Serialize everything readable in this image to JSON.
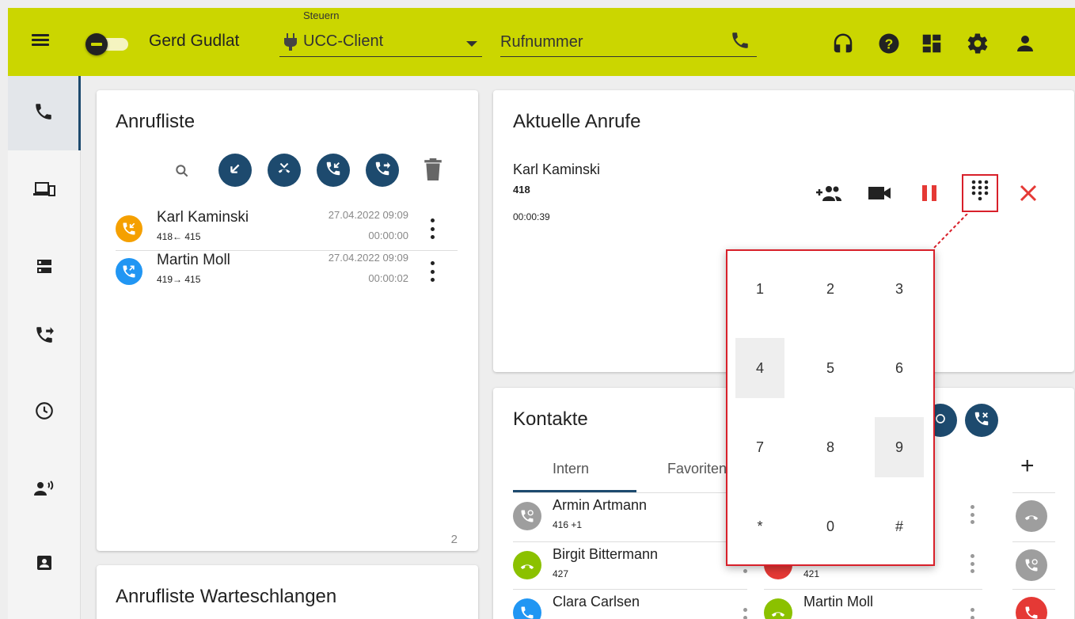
{
  "topbar": {
    "user_name": "Gerd Gudlat",
    "control_label": "Steuern",
    "client_value": "UCC-Client",
    "phone_placeholder": "Rufnummer",
    "bg_color": "#cbd600",
    "icons": [
      "menu-icon",
      "status-toggle",
      "headset-icon",
      "help-icon",
      "dashboard-icon",
      "settings-icon",
      "user-icon"
    ]
  },
  "sidenav": {
    "items": [
      "phone-icon",
      "devices-icon",
      "server-icon",
      "call-forward-icon",
      "clock-icon",
      "voice-icon",
      "contact-card-icon"
    ],
    "active_index": 0
  },
  "call_list": {
    "title": "Anrufliste",
    "footer_count": "2",
    "filter_icons": [
      "search-icon",
      "outgoing-call-icon",
      "missed-call-icon",
      "incoming-call-icon",
      "forwarded-call-icon",
      "delete-icon"
    ],
    "rows": [
      {
        "name": "Karl Kaminski",
        "from": "418",
        "arrow": "←",
        "to": "415",
        "date": "27.04.2022 09:09",
        "duration": "00:00:00",
        "type": "incoming",
        "color": "#f5a000"
      },
      {
        "name": "Martin Moll",
        "from": "419",
        "arrow": "→",
        "to": "415",
        "date": "27.04.2022 09:09",
        "duration": "00:00:02",
        "type": "outgoing",
        "color": "#2196f3"
      }
    ]
  },
  "queue_list": {
    "title": "Anrufliste Warteschlangen"
  },
  "current_calls": {
    "title": "Aktuelle Anrufe",
    "call": {
      "name": "Karl Kaminski",
      "number": "418",
      "duration": "00:00:39"
    },
    "actions": [
      "add-participant-icon",
      "video-icon",
      "hold-icon",
      "dialpad-icon",
      "hangup-icon"
    ],
    "hold_color": "#e53935"
  },
  "dialpad": {
    "keys": [
      "1",
      "2",
      "3",
      "4",
      "5",
      "6",
      "7",
      "8",
      "9",
      "*",
      "0",
      "#"
    ],
    "highlight_color": "#d8202a"
  },
  "contacts": {
    "title": "Kontakte",
    "tabs": [
      "Intern",
      "Favoriten"
    ],
    "active_tab": "Intern",
    "add_label": "+",
    "left": [
      {
        "name": "Armin Artmann",
        "number": "416 +1",
        "color": "#9e9e9e"
      },
      {
        "name": "Birgit Bittermann",
        "number": "427",
        "color": "#8bc100"
      },
      {
        "name": "Clara Carlsen",
        "number": "",
        "color": "#2196f3"
      }
    ],
    "right": [
      {
        "name": "",
        "number": "421",
        "color": "#e53935"
      },
      {
        "name": "Martin Moll",
        "number": "",
        "color": "#8bc100"
      }
    ],
    "side_status": [
      "#9e9e9e",
      "#9e9e9e",
      "#e53935"
    ]
  }
}
